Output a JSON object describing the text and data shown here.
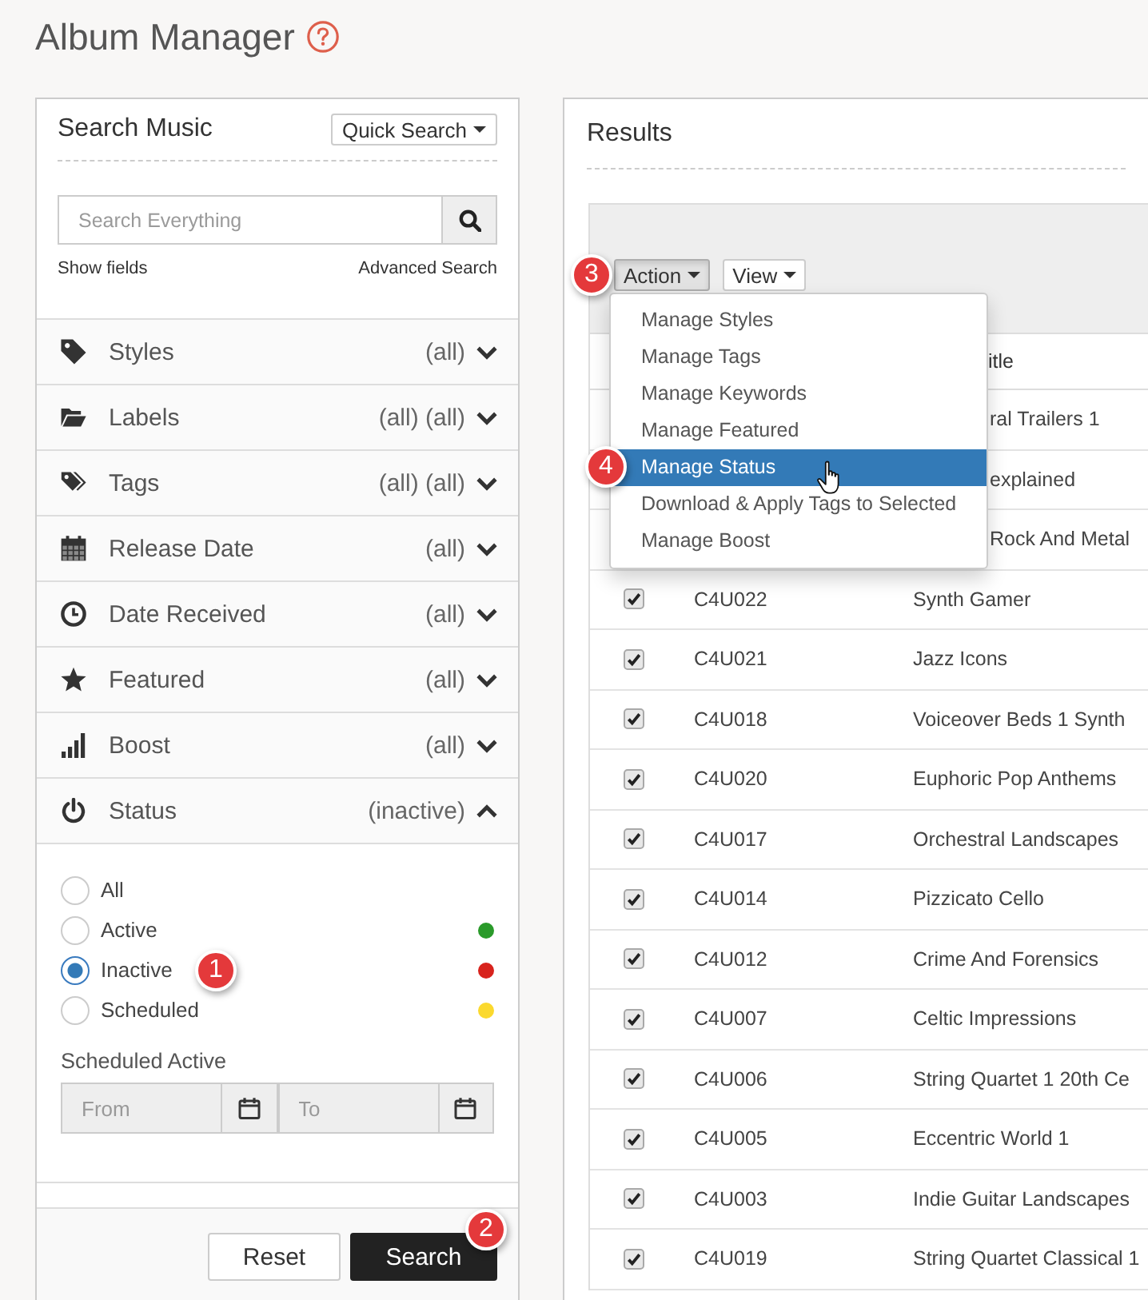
{
  "page": {
    "title": "Album Manager"
  },
  "search_panel": {
    "title": "Search Music",
    "mode_button": "Quick Search",
    "search": {
      "placeholder": "Search Everything"
    },
    "links": [
      "Show fields",
      "Advanced Search"
    ],
    "filters": [
      {
        "label": "Styles",
        "value": "(all)",
        "expanded": false
      },
      {
        "label": "Labels",
        "value": "(all) (all)",
        "expanded": false
      },
      {
        "label": "Tags",
        "value": "(all) (all)",
        "expanded": false
      },
      {
        "label": "Release Date",
        "value": "(all)",
        "expanded": false
      },
      {
        "label": "Date Received",
        "value": "(all)",
        "expanded": false
      },
      {
        "label": "Featured",
        "value": "(all)",
        "expanded": false
      },
      {
        "label": "Boost",
        "value": "(all)",
        "expanded": false
      },
      {
        "label": "Status",
        "value": "(inactive)",
        "expanded": true,
        "options": [
          {
            "label": "All",
            "selected": false
          },
          {
            "label": "Active",
            "selected": false,
            "color": "#2a9a2a"
          },
          {
            "label": "Inactive",
            "selected": true,
            "color": "#d8231d",
            "callout": "1"
          },
          {
            "label": "Scheduled",
            "selected": false,
            "color": "#fbd92e"
          }
        ],
        "scheduled_active": {
          "label": "Scheduled Active",
          "from": {
            "placeholder": "From",
            "disabled": true
          },
          "to": {
            "placeholder": "To",
            "disabled": true
          }
        }
      }
    ],
    "buttons": [
      {
        "kind": "secondary",
        "label": "Reset"
      },
      {
        "kind": "primary",
        "label": "Search",
        "callout": "2"
      }
    ]
  },
  "results_panel": {
    "title": "Results",
    "toolbar": [
      {
        "label": "Action",
        "expanded": true,
        "callout": "3",
        "menu": [
          {
            "label": "Manage Styles",
            "selected": false
          },
          {
            "label": "Manage Tags",
            "selected": false
          },
          {
            "label": "Manage Keywords",
            "selected": false
          },
          {
            "label": "Manage Featured",
            "selected": false
          },
          {
            "label": "Manage Status",
            "selected": true,
            "callout": "4"
          },
          {
            "label": "Download & Apply Tags to Selected",
            "selected": false
          },
          {
            "label": "Manage Boost",
            "selected": false
          }
        ]
      },
      {
        "label": "View",
        "expanded": false
      }
    ],
    "table": {
      "header": "itle",
      "rows": [
        {
          "title": "ral Trailers 1"
        },
        {
          "title": "explained"
        },
        {
          "title": "Rock And Metal"
        },
        {
          "checked": true,
          "column_2": "C4U022",
          "title": "Synth Gamer"
        },
        {
          "checked": true,
          "column_2": "C4U021",
          "title": "Jazz Icons"
        },
        {
          "checked": true,
          "column_2": "C4U018",
          "title": "Voiceover Beds 1 Synth"
        },
        {
          "checked": true,
          "column_2": "C4U020",
          "title": "Euphoric Pop Anthems"
        },
        {
          "checked": true,
          "column_2": "C4U017",
          "title": "Orchestral Landscapes"
        },
        {
          "checked": true,
          "column_2": "C4U014",
          "title": "Pizzicato Cello"
        },
        {
          "checked": true,
          "column_2": "C4U012",
          "title": "Crime And Forensics"
        },
        {
          "checked": true,
          "column_2": "C4U007",
          "title": "Celtic Impressions"
        },
        {
          "checked": true,
          "column_2": "C4U006",
          "title": "String Quartet 1 20th Ce"
        },
        {
          "checked": true,
          "column_2": "C4U005",
          "title": "Eccentric World 1"
        },
        {
          "checked": true,
          "column_2": "C4U003",
          "title": "Indie Guitar Landscapes"
        },
        {
          "checked": true,
          "column_2": "C4U019",
          "title": "String Quartet Classical 1"
        }
      ]
    }
  }
}
